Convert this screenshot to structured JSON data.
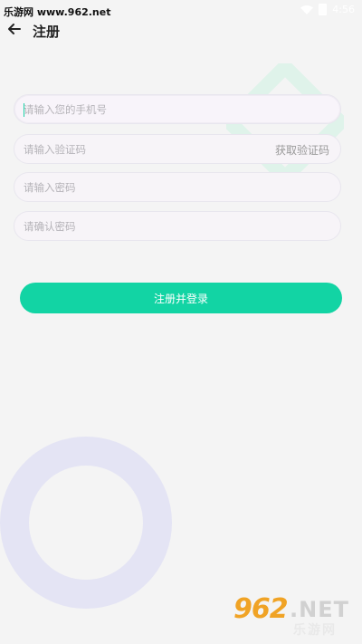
{
  "status_bar": {
    "site_text": "乐游网 www.962.net",
    "time": "4:56"
  },
  "header": {
    "title": "注册"
  },
  "form": {
    "phone_placeholder": "请输入您的手机号",
    "code_placeholder": "请输入验证码",
    "get_code_label": "获取验证码",
    "password_placeholder": "请输入密码",
    "confirm_placeholder": "请确认密码",
    "submit_label": "注册并登录"
  },
  "watermark": {
    "num": "962",
    "net": ".NET",
    "cn": "乐游网"
  },
  "colors": {
    "accent": "#12d4a4",
    "ring": "#e4e4f4",
    "diamond": "#dff3ea"
  }
}
